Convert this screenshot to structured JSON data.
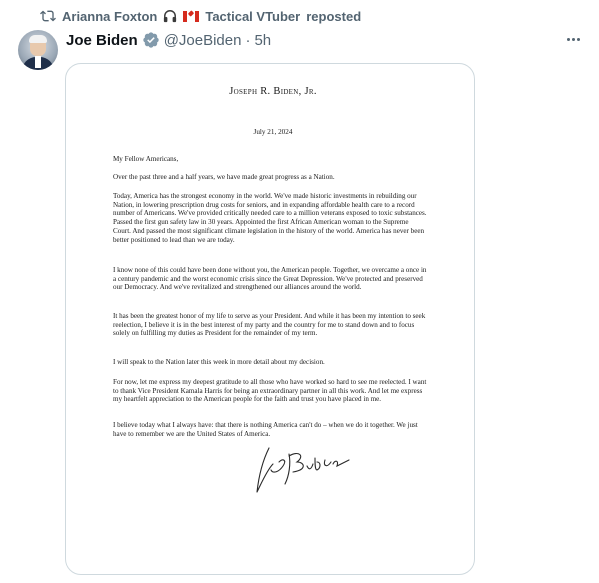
{
  "repost": {
    "icon": "repost-icon",
    "user": "Arianna Foxton",
    "emoji_icons": [
      "headphones-icon",
      "canada-flag-icon"
    ],
    "suffix": "Tactical VTuber",
    "label": "reposted"
  },
  "post": {
    "display_name": "Joe Biden",
    "verified_icon": "verified-badge-icon",
    "handle": "@JoeBiden",
    "separator": "·",
    "time": "5h",
    "more_icon": "more-options-icon"
  },
  "letter": {
    "letterhead": "Joseph R. Biden, Jr.",
    "date": "July 21, 2024",
    "salutation": "My Fellow Americans,",
    "paragraphs": [
      "Over the past three and a half years, we have made great progress as a Nation.",
      "Today, America has the strongest economy in the world. We've made historic investments in rebuilding our Nation, in lowering prescription drug costs for seniors, and in expanding affordable health care to a record number of Americans. We've provided critically needed care to a million veterans exposed to toxic substances. Passed the first gun safety law in 30 years. Appointed the first African American woman to the Supreme Court. And passed the most significant climate legislation in the history of the world. America has never been better positioned to lead than we are today.",
      "I know none of this could have been done without you, the American people. Together, we overcame a once in a century pandemic and the worst economic crisis since the Great Depression. We've protected and preserved our Democracy. And we've revitalized and strengthened our alliances around the world.",
      "It has been the greatest honor of my life to serve as your President. And while it has been my intention to seek reelection, I believe it is in the best interest of my party and the country for me to stand down and to focus solely on fulfilling my duties as President for the remainder of my term.",
      "I will speak to the Nation later this week in more detail about my decision.",
      "For now, let me express my deepest gratitude to all those who have worked so hard to see me reelected. I want to thank Vice President Kamala Harris for being an extraordinary partner in all this work. And let me express my heartfelt appreciation to the American people for the faith and trust you have placed in me.",
      "I believe today what I always have: that there is nothing America can't do – when we do it together. We just have to remember we are the United States of America."
    ],
    "signature": "Joe Biden"
  },
  "colors": {
    "secondary_text": "#536471",
    "primary_text": "#0f1419",
    "verified_badge": "#829aab",
    "card_border": "#cfd9de"
  }
}
